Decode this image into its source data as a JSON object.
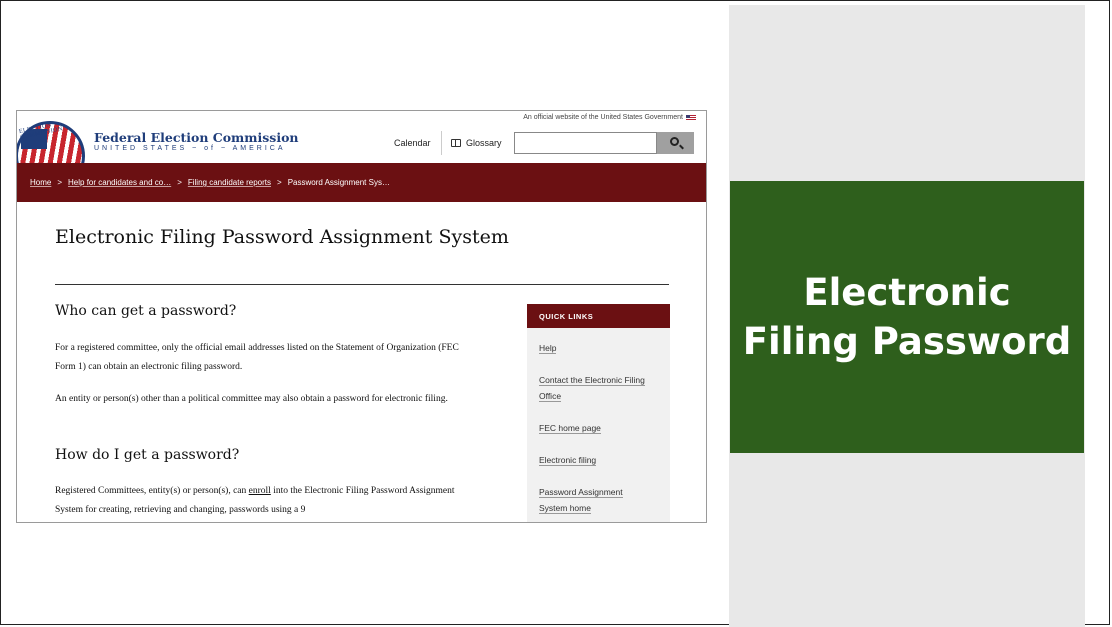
{
  "slide": {
    "callout_title": "Electronic Filing Password"
  },
  "site": {
    "gov_banner": "An official website of the United States Government",
    "seal_text": "ELECTION COMMISSION",
    "org_name": "Federal Election Commission",
    "org_sub": "UNITED STATES ~ of ~ AMERICA",
    "nav_calendar": "Calendar",
    "nav_glossary": "Glossary",
    "search_placeholder": ""
  },
  "breadcrumb": {
    "items": [
      "Home",
      "Help for candidates and co…",
      "Filing candidate reports"
    ],
    "current": "Password Assignment Sys…",
    "separator": ">"
  },
  "content": {
    "title": "Electronic Filing Password Assignment System",
    "sections": [
      {
        "heading": "Who can get a password?",
        "paragraphs": [
          "For a registered committee, only the official email addresses listed on the Statement of Organization (FEC Form 1) can obtain an electronic filing password.",
          "An entity or person(s) other than a political committee may also obtain a password for electronic filing."
        ]
      },
      {
        "heading": "How do I get a password?",
        "para_before": "Registered Committees, entity(s) or person(s), can ",
        "para_link": "enroll",
        "para_after": " into the Electronic Filing Password Assignment System for creating, retrieving and changing, passwords using a 9"
      }
    ]
  },
  "quick_links": {
    "heading": "QUICK LINKS",
    "items": [
      "Help",
      "Contact the Electronic Filing Office",
      "FEC home page",
      "Electronic filing",
      "Password Assignment System home"
    ]
  },
  "colors": {
    "accent_green": "#2e5f1c",
    "fec_maroon": "#6b1012",
    "fec_blue": "#1f3d7a",
    "panel_gray": "#e8e8e8"
  }
}
